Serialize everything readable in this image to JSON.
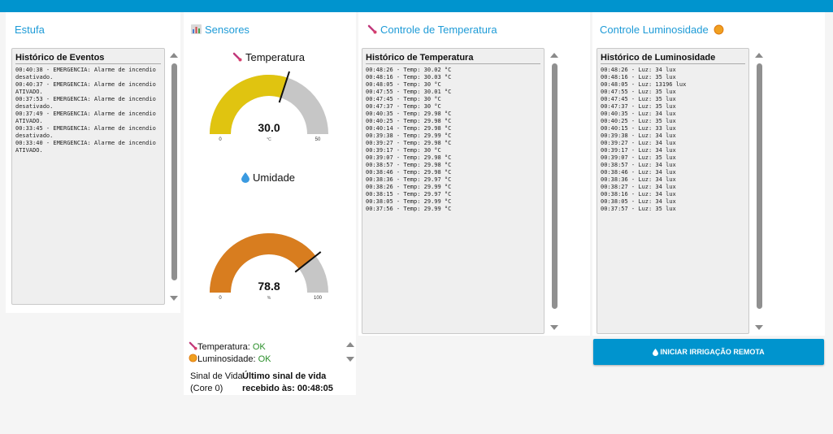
{
  "colors": {
    "accent": "#0094ce",
    "title": "#1e9bd7",
    "temp_fill": "#e0c410",
    "hum_fill": "#d87d1f",
    "gauge_bg": "#c6c6c6",
    "ok": "#2a8f2a"
  },
  "estufa": {
    "title": "Estufa",
    "panel_title": "Histórico de Eventos",
    "events": [
      "00:40:38 - EMERGENCIA: Alarme de incendio desativado.",
      "00:40:37 - EMERGENCIA: Alarme de incendio ATIVADO.",
      "00:37:53 - EMERGENCIA: Alarme de incendio desativado.",
      "00:37:49 - EMERGENCIA: Alarme de incendio ATIVADO.",
      "00:33:45 - EMERGENCIA: Alarme de incendio desativado.",
      "00:33:40 - EMERGENCIA: Alarme de incendio ATIVADO."
    ]
  },
  "sensores": {
    "title": "Sensores",
    "icon": "bar-chart-icon",
    "temperature": {
      "label": "Temperatura",
      "icon": "thermometer-icon",
      "value": 30.0,
      "value_text": "30.0",
      "unit": "°C",
      "min": 0,
      "max": 50,
      "min_text": "0",
      "max_text": "50"
    },
    "humidity": {
      "label": "Umidade",
      "icon": "water-drop-icon",
      "value": 78.8,
      "value_text": "78.8",
      "unit": "%",
      "min": 0,
      "max": 100,
      "min_text": "0",
      "max_text": "100"
    },
    "status": {
      "temp_label": "Temperatura: ",
      "temp_value": "OK",
      "lum_label": "Luminosidade: ",
      "lum_value": "OK",
      "heartbeat_label_1": "Sinal de Vida",
      "heartbeat_label_2": "(Core 0)",
      "heartbeat_text_1": "Último sinal de vida",
      "heartbeat_text_2": "recebido às: 00:48:05"
    }
  },
  "temperatura": {
    "title": "Controle de Temperatura",
    "icon": "thermometer-icon",
    "panel_title": "Histórico de Temperatura",
    "history": [
      "00:48:26 - Temp: 30.02 °C",
      "00:48:16 - Temp: 30.03 °C",
      "00:48:05 - Temp: 30 °C",
      "00:47:55 - Temp: 30.01 °C",
      "00:47:45 - Temp: 30 °C",
      "00:47:37 - Temp: 30 °C",
      "00:40:35 - Temp: 29.98 °C",
      "00:40:25 - Temp: 29.98 °C",
      "00:40:14 - Temp: 29.98 °C",
      "00:39:38 - Temp: 29.99 °C",
      "00:39:27 - Temp: 29.98 °C",
      "00:39:17 - Temp: 30 °C",
      "00:39:07 - Temp: 29.98 °C",
      "00:38:57 - Temp: 29.98 °C",
      "00:38:46 - Temp: 29.98 °C",
      "00:38:36 - Temp: 29.97 °C",
      "00:38:26 - Temp: 29.99 °C",
      "00:38:15 - Temp: 29.97 °C",
      "00:38:05 - Temp: 29.99 °C",
      "00:37:56 - Temp: 29.99 °C"
    ]
  },
  "luminosidade": {
    "title": "Controle Luminosidade",
    "icon": "sun-icon",
    "panel_title": "Histórico de Luminosidade",
    "history": [
      "00:48:26 - Luz: 34 lux",
      "00:48:16 - Luz: 35 lux",
      "00:48:05 - Luz: 13196 lux",
      "00:47:55 - Luz: 35 lux",
      "00:47:45 - Luz: 35 lux",
      "00:47:37 - Luz: 35 lux",
      "00:40:35 - Luz: 34 lux",
      "00:40:25 - Luz: 35 lux",
      "00:40:15 - Luz: 33 lux",
      "00:39:38 - Luz: 34 lux",
      "00:39:27 - Luz: 34 lux",
      "00:39:17 - Luz: 34 lux",
      "00:39:07 - Luz: 35 lux",
      "00:38:57 - Luz: 34 lux",
      "00:38:46 - Luz: 34 lux",
      "00:38:36 - Luz: 34 lux",
      "00:38:27 - Luz: 34 lux",
      "00:38:16 - Luz: 34 lux",
      "00:38:05 - Luz: 34 lux",
      "00:37:57 - Luz: 35 lux"
    ],
    "button_label": "INICIAR IRRIGAÇÃO REMOTA",
    "button_icon": "water-drop-icon"
  }
}
